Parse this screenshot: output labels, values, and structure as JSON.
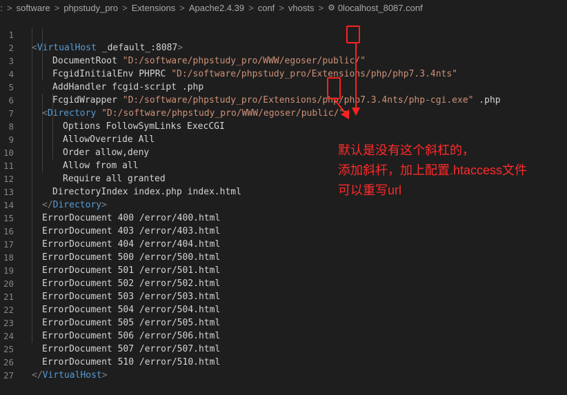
{
  "breadcrumb": {
    "items": [
      "D:",
      "software",
      "phpstudy_pro",
      "Extensions",
      "Apache2.4.39",
      "conf",
      "vhosts"
    ],
    "file": "0localhost_8087.conf",
    "separator": ">"
  },
  "editor": {
    "line_numbers": [
      "1",
      "2",
      "3",
      "4",
      "5",
      "6",
      "7",
      "8",
      "9",
      "10",
      "11",
      "12",
      "13",
      "14",
      "15",
      "16",
      "17",
      "18",
      "19",
      "20",
      "21",
      "22",
      "23",
      "24",
      "25",
      "26",
      "27"
    ],
    "lines": {
      "l1": {
        "open": "<",
        "name": "VirtualHost",
        "rest": " _default_:8087",
        "close": ">"
      },
      "l2": {
        "key": "DocumentRoot ",
        "str": "\"D:/software/phpstudy_pro/WWW/egoser/public/\""
      },
      "l3": {
        "key": "FcgidInitialEnv PHPRC ",
        "str": "\"D:/software/phpstudy_pro/Extensions/php/php7.3.4nts\""
      },
      "l4": {
        "text": "AddHandler fcgid-script .php"
      },
      "l5": {
        "key": "FcgidWrapper ",
        "str": "\"D:/software/phpstudy_pro/Extensions/php/php7.3.4nts/php-cgi.exe\"",
        "rest": " .php"
      },
      "l6": {
        "open": "<",
        "name": "Directory",
        "space": " ",
        "str": "\"D:/software/phpstudy_pro/WWW/egoser/public/\"",
        "close": ">"
      },
      "l7": {
        "text": "Options FollowSymLinks ExecCGI"
      },
      "l8": {
        "text": "AllowOverride All"
      },
      "l9": {
        "text": "Order allow,deny"
      },
      "l10": {
        "text": "Allow from all"
      },
      "l11": {
        "text": "Require all granted"
      },
      "l12": {
        "text": "DirectoryIndex index.php index.html"
      },
      "l13": {
        "open": "</",
        "name": "Directory",
        "close": ">"
      },
      "l14": {
        "text": "ErrorDocument 400 /error/400.html"
      },
      "l15": {
        "text": "ErrorDocument 403 /error/403.html"
      },
      "l16": {
        "text": "ErrorDocument 404 /error/404.html"
      },
      "l17": {
        "text": "ErrorDocument 500 /error/500.html"
      },
      "l18": {
        "text": "ErrorDocument 501 /error/501.html"
      },
      "l19": {
        "text": "ErrorDocument 502 /error/502.html"
      },
      "l20": {
        "text": "ErrorDocument 503 /error/503.html"
      },
      "l21": {
        "text": "ErrorDocument 504 /error/504.html"
      },
      "l22": {
        "text": "ErrorDocument 505 /error/505.html"
      },
      "l23": {
        "text": "ErrorDocument 506 /error/506.html"
      },
      "l24": {
        "text": "ErrorDocument 507 /error/507.html"
      },
      "l25": {
        "text": "ErrorDocument 510 /error/510.html"
      },
      "l26": {
        "open": "</",
        "name": "VirtualHost",
        "close": ">"
      }
    }
  },
  "annotation": {
    "line1": "默认是没有这个斜杠的，",
    "line2": "添加斜杆，加上配置.htaccess文件",
    "line3": "可以重写url"
  },
  "colors": {
    "background": "#1e1e1e",
    "string": "#ce9178",
    "tag_name": "#569cd6",
    "tag_bracket": "#808080",
    "plain": "#d4d4d4",
    "line_number": "#858585",
    "annotation": "#ff2a2a"
  }
}
